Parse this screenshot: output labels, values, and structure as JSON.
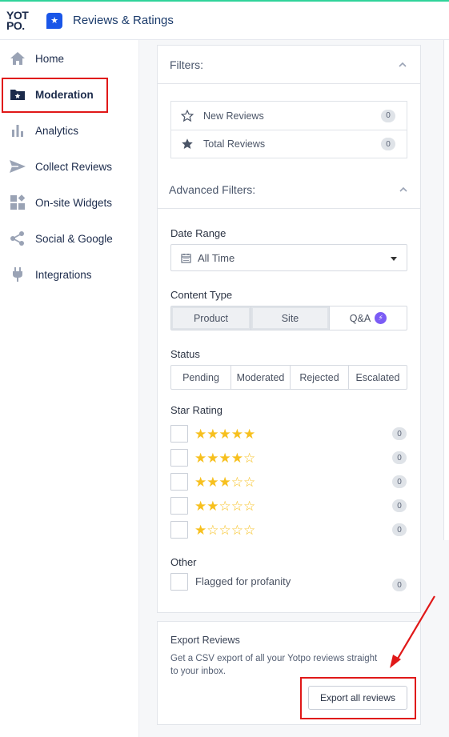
{
  "app": {
    "logo_line1": "YOT",
    "logo_line2": "PO.",
    "title": "Reviews & Ratings",
    "accent": "#2fd39a",
    "brand_blue": "#1a56e8"
  },
  "sidebar": {
    "items": [
      {
        "label": "Home",
        "icon": "home-icon"
      },
      {
        "label": "Moderation",
        "icon": "folder-star-icon",
        "active": true
      },
      {
        "label": "Analytics",
        "icon": "bar-chart-icon"
      },
      {
        "label": "Collect Reviews",
        "icon": "send-icon"
      },
      {
        "label": "On-site Widgets",
        "icon": "widgets-icon"
      },
      {
        "label": "Social & Google",
        "icon": "share-icon"
      },
      {
        "label": "Integrations",
        "icon": "plug-icon"
      }
    ]
  },
  "filters": {
    "title": "Filters:",
    "rows": [
      {
        "label": "New Reviews",
        "icon": "star-outline-icon",
        "count": "0"
      },
      {
        "label": "Total Reviews",
        "icon": "star-filled-icon",
        "count": "0"
      }
    ]
  },
  "advanced": {
    "title": "Advanced Filters:",
    "date_range": {
      "label": "Date Range",
      "value": "All Time",
      "icon": "calendar-icon"
    },
    "content_type": {
      "label": "Content Type",
      "options": [
        "Product",
        "Site",
        "Q&A"
      ],
      "selected": [
        "Product",
        "Site"
      ]
    },
    "status": {
      "label": "Status",
      "options": [
        "Pending",
        "Moderated",
        "Rejected",
        "Escalated"
      ]
    },
    "star_rating": {
      "label": "Star Rating",
      "rows": [
        {
          "stars": 5,
          "count": "0"
        },
        {
          "stars": 4,
          "count": "0"
        },
        {
          "stars": 3,
          "count": "0"
        },
        {
          "stars": 2,
          "count": "0"
        },
        {
          "stars": 1,
          "count": "0"
        }
      ],
      "star_color": "#f7c01e"
    },
    "other": {
      "label": "Other",
      "flagged_label": "Flagged for profanity",
      "count": "0"
    }
  },
  "export": {
    "title": "Export Reviews",
    "description": "Get a CSV export of all your Yotpo reviews straight to your inbox.",
    "button_label": "Export all reviews"
  },
  "annotation_color": "#e01818"
}
